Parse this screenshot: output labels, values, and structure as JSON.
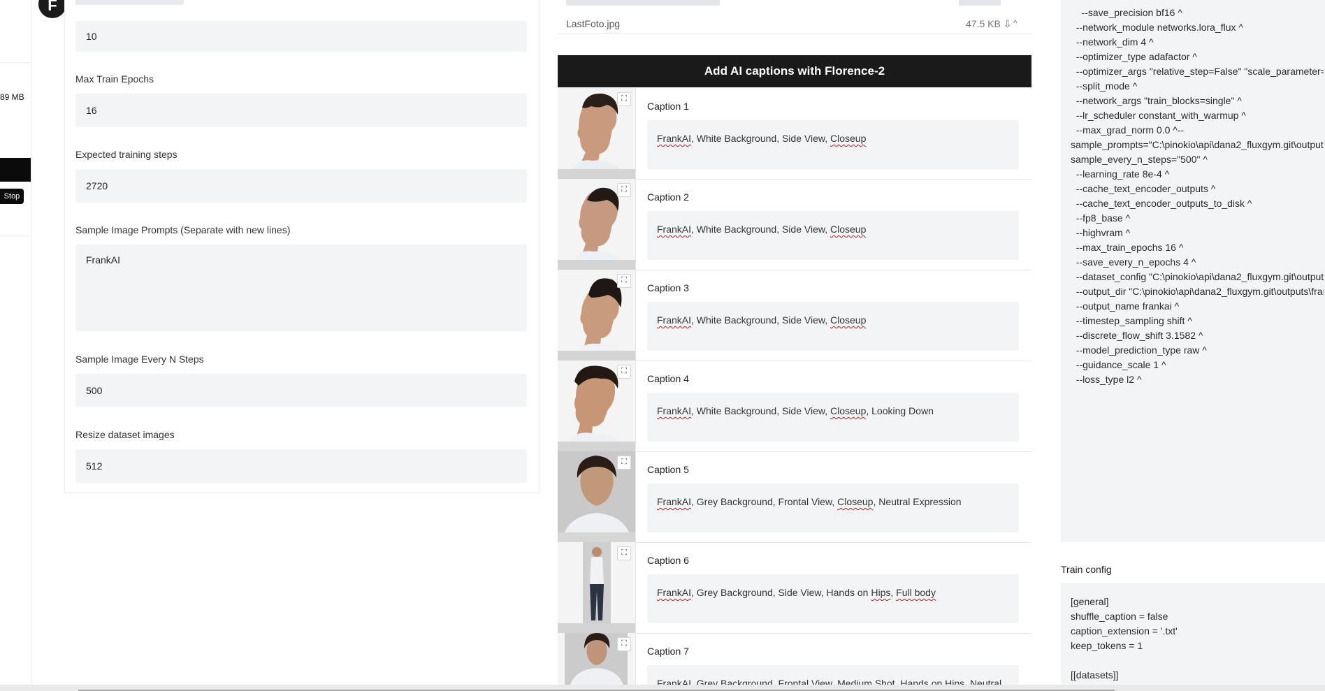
{
  "left_strip": {
    "mb_text": "89 MB",
    "stop_label": "Stop"
  },
  "logo": {
    "letter": "F"
  },
  "settings": {
    "top_value": "10",
    "max_epochs": {
      "label": "Max Train Epochs",
      "value": "16"
    },
    "expected_steps": {
      "label": "Expected training steps",
      "value": "2720"
    },
    "sample_prompts": {
      "label": "Sample Image Prompts (Separate with new lines)",
      "value": "FrankAI"
    },
    "sample_every": {
      "label": "Sample Image Every N Steps",
      "value": "500"
    },
    "resize": {
      "label": "Resize dataset images",
      "value": "512"
    }
  },
  "files": {
    "name": "LastFoto.jpg",
    "size": "47.5 KB ⇩",
    "caret": "^"
  },
  "captions_header": "Add AI captions with Florence-2",
  "captions": [
    {
      "label": "Caption 1",
      "parts": [
        "FrankAI",
        ", White Background, Side View, ",
        "Closeup",
        "",
        ""
      ]
    },
    {
      "label": "Caption 2",
      "parts": [
        "FrankAI",
        ", White Background, Side View, ",
        "Closeup",
        "",
        ""
      ]
    },
    {
      "label": "Caption 3",
      "parts": [
        "FrankAI",
        ", White Background, Side View, ",
        "Closeup",
        "",
        ""
      ]
    },
    {
      "label": "Caption 4",
      "parts": [
        "FrankAI",
        ", White Background, Side View, ",
        "Closeup",
        ", Looking Down",
        ""
      ]
    },
    {
      "label": "Caption 5",
      "parts": [
        "FrankAI",
        ", Grey Background, Frontal View, ",
        "Closeup",
        ", Neutral Expression",
        ""
      ]
    },
    {
      "label": "Caption 6",
      "parts": [
        "FrankAI",
        ", Grey Background, Side View, Hands on ",
        "Hips",
        ", ",
        "Full body"
      ]
    },
    {
      "label": "Caption 7",
      "parts": [
        "FrankAI",
        ", Grey Background, Frontal View, Medium Shot, Hands on Hips, Neutral",
        "",
        "",
        ""
      ]
    }
  ],
  "command_text": "    --save_precision bf16 ^\n  --network_module networks.lora_flux ^\n  --network_dim 4 ^\n  --optimizer_type adafactor ^\n  --optimizer_args \"relative_step=False\" \"scale_parameter=False\" \"warmup_init=False\" ^\n  --split_mode ^\n  --network_args \"train_blocks=single\" ^\n  --lr_scheduler constant_with_warmup ^\n  --max_grad_norm 0.0 ^--\nsample_prompts=\"C:\\pinokio\\api\\dana2_fluxgym.git\\outputs\\frankai\\sample_prompts.txt\" --\nsample_every_n_steps=\"500\" ^\n  --learning_rate 8e-4 ^\n  --cache_text_encoder_outputs ^\n  --cache_text_encoder_outputs_to_disk ^\n  --fp8_base ^\n  --highvram ^\n  --max_train_epochs 16 ^\n  --save_every_n_epochs 4 ^\n  --dataset_config \"C:\\pinokio\\api\\dana2_fluxgym.git\\outputs\\frankai\\dataset.toml\" ^\n  --output_dir \"C:\\pinokio\\api\\dana2_fluxgym.git\\outputs\\frankai\" ^\n  --output_name frankai ^\n  --timestep_sampling shift ^\n  --discrete_flow_shift 3.1582 ^\n  --model_prediction_type raw ^\n  --guidance_scale 1 ^\n  --loss_type l2 ^",
  "train_config": {
    "label": "Train config",
    "text": "[general]\nshuffle_caption = false\ncaption_extension = '.txt'\nkeep_tokens = 1\n\n[[datasets]]"
  }
}
